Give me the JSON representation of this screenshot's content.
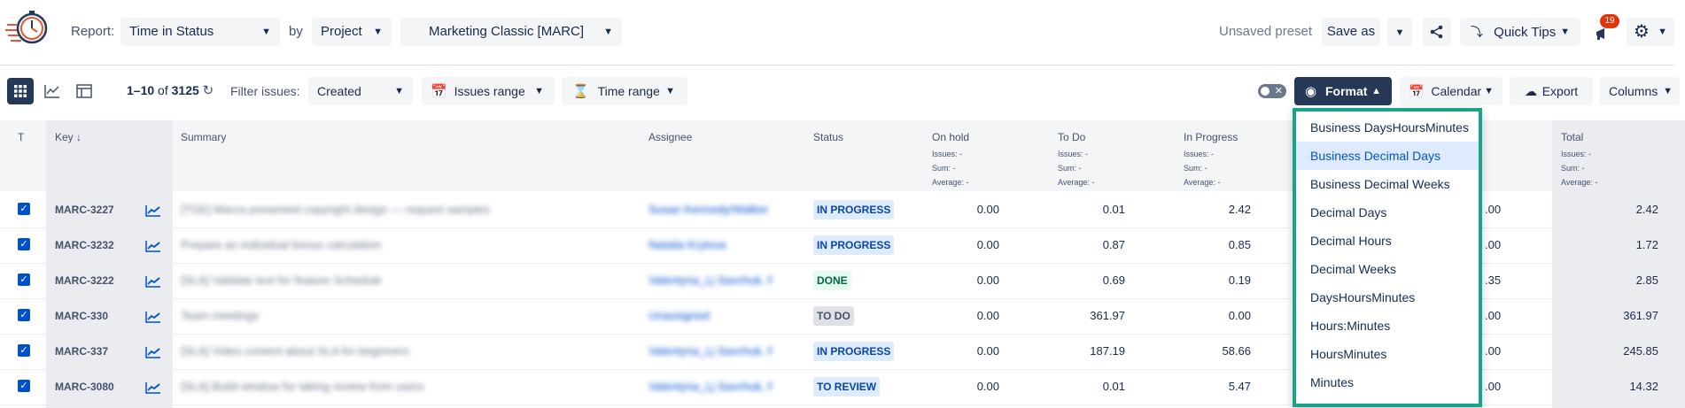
{
  "header": {
    "report_label": "Report:",
    "report_value": "Time in Status",
    "by_label": "by",
    "by_value": "Project",
    "project_value": "Marketing Classic [MARC]",
    "unsaved_preset": "Unsaved preset",
    "save_as": "Save as",
    "quick_tips": "Quick Tips",
    "notification_count": "19"
  },
  "toolbar": {
    "range_prefix": "1–10",
    "range_of": "of",
    "range_total": "3125",
    "filter_label": "Filter issues:",
    "filter_value": "Created",
    "issues_range": "Issues range",
    "time_range": "Time range",
    "format": "Format",
    "calendar": "Calendar",
    "export": "Export",
    "columns": "Columns"
  },
  "table": {
    "headers": {
      "t": "T",
      "key": "Key",
      "summary": "Summary",
      "assignee": "Assignee",
      "status": "Status",
      "on_hold": "On hold",
      "to_do": "To Do",
      "in_progress": "In Progress",
      "total": "Total"
    },
    "sub": {
      "issues": "Issues: -",
      "sum": "Sum: -",
      "average": "Average: -"
    },
    "rows": [
      {
        "key": "MARC-3227",
        "summary": "[TGE] Marca presented copyright design — request samples",
        "assignee": "Susan Kennedy/Walker",
        "status": "IN PROGRESS",
        "on_hold": "0.00",
        "to_do": "0.01",
        "in_progress": "2.42",
        "hidden": ".00",
        "total": "2.42"
      },
      {
        "key": "MARC-3232",
        "summary": "Prepare an individual bonus calculation",
        "assignee": "Natalia Krylova",
        "status": "IN PROGRESS",
        "on_hold": "0.00",
        "to_do": "0.87",
        "in_progress": "0.85",
        "hidden": ".00",
        "total": "1.72"
      },
      {
        "key": "MARC-3222",
        "summary": "[SLA] Validate text for feature Schedule",
        "assignee": "Valentyna_Lj Savchuk, Rem",
        "status": "DONE",
        "on_hold": "0.00",
        "to_do": "0.69",
        "in_progress": "0.19",
        "hidden": ".35",
        "total": "2.85"
      },
      {
        "key": "MARC-330",
        "summary": "Team meetings",
        "assignee": "Unassigned",
        "status": "TO DO",
        "on_hold": "0.00",
        "to_do": "361.97",
        "in_progress": "0.00",
        "hidden": ".00",
        "total": "361.97"
      },
      {
        "key": "MARC-337",
        "summary": "[SLA] Video content about SLA for beginners",
        "assignee": "Valentyna_Lj Savchuk, Rem",
        "status": "IN PROGRESS",
        "on_hold": "0.00",
        "to_do": "187.19",
        "in_progress": "58.66",
        "hidden": ".00",
        "total": "245.85"
      },
      {
        "key": "MARC-3080",
        "summary": "[SLA] Build window for taking review from users",
        "assignee": "Valentyna_Lj Savchuk, Rem",
        "status": "TO REVIEW",
        "on_hold": "0.00",
        "to_do": "0.01",
        "in_progress": "5.47",
        "hidden": ".00",
        "total": "14.32"
      }
    ]
  },
  "format_dropdown": {
    "items": [
      "Business DaysHoursMinutes",
      "Business Decimal Days",
      "Business Decimal Weeks",
      "Decimal Days",
      "Decimal Hours",
      "Decimal Weeks",
      "DaysHoursMinutes",
      "Hours:Minutes",
      "HoursMinutes",
      "Minutes"
    ],
    "selected": "Business Decimal Days"
  },
  "colors": {
    "accent": "#0052cc",
    "format_button": "#253858",
    "highlight_border": "#1aa388",
    "badge": "#de350b"
  }
}
